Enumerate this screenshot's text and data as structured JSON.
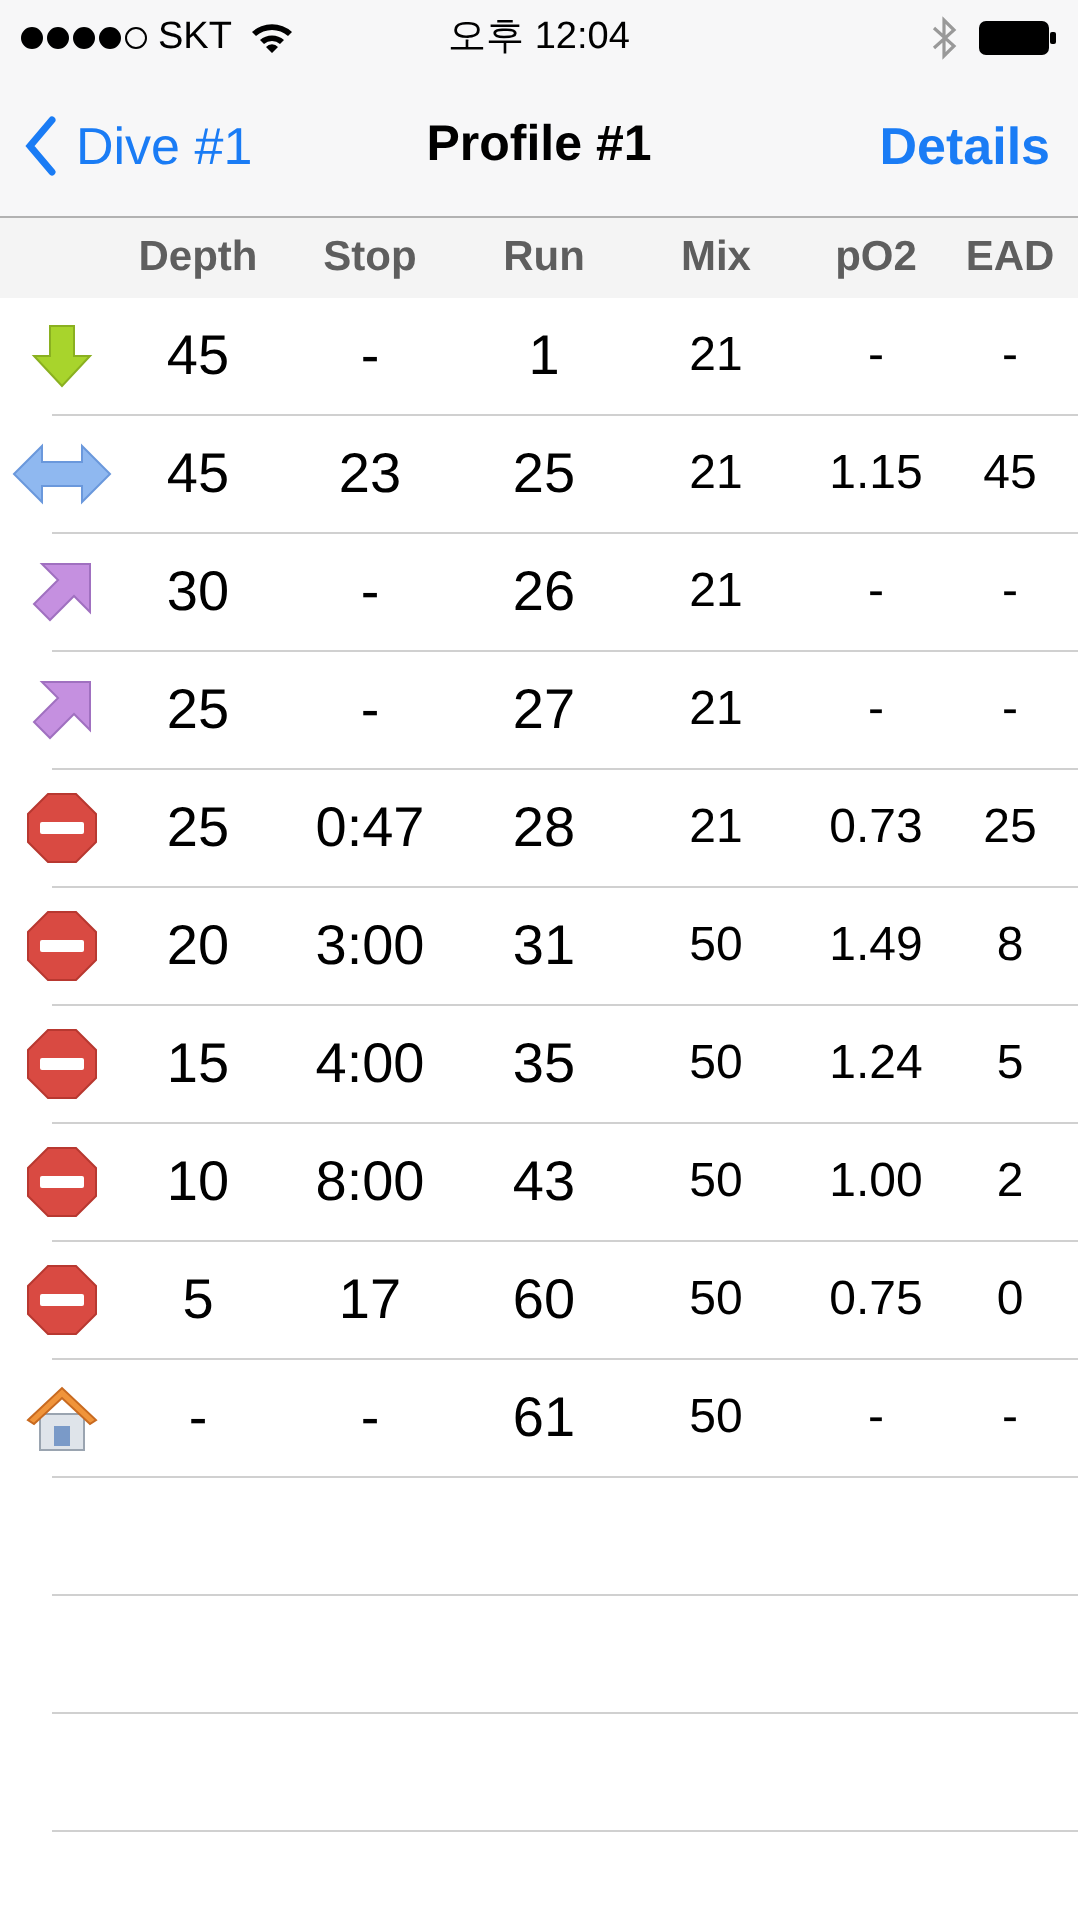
{
  "status_bar": {
    "carrier": "SKT",
    "time": "오후 12:04"
  },
  "nav": {
    "back": "Dive #1",
    "title": "Profile #1",
    "action": "Details"
  },
  "columns": [
    "Depth",
    "Stop",
    "Run",
    "Mix",
    "pO2",
    "EAD"
  ],
  "rows": [
    {
      "kind": "descent",
      "cells": [
        "45",
        "-",
        "1",
        "21",
        "-",
        "-"
      ]
    },
    {
      "kind": "level",
      "cells": [
        "45",
        "23",
        "25",
        "21",
        "1.15",
        "45"
      ]
    },
    {
      "kind": "ascent",
      "cells": [
        "30",
        "-",
        "26",
        "21",
        "-",
        "-"
      ]
    },
    {
      "kind": "ascent",
      "cells": [
        "25",
        "-",
        "27",
        "21",
        "-",
        "-"
      ]
    },
    {
      "kind": "stop",
      "cells": [
        "25",
        "0:47",
        "28",
        "21",
        "0.73",
        "25"
      ]
    },
    {
      "kind": "stop",
      "cells": [
        "20",
        "3:00",
        "31",
        "50",
        "1.49",
        "8"
      ]
    },
    {
      "kind": "stop",
      "cells": [
        "15",
        "4:00",
        "35",
        "50",
        "1.24",
        "5"
      ]
    },
    {
      "kind": "stop",
      "cells": [
        "10",
        "8:00",
        "43",
        "50",
        "1.00",
        "2"
      ]
    },
    {
      "kind": "stop",
      "cells": [
        "5",
        "17",
        "60",
        "50",
        "0.75",
        "0"
      ]
    },
    {
      "kind": "surface",
      "cells": [
        "-",
        "-",
        "61",
        "50",
        "-",
        "-"
      ]
    }
  ]
}
